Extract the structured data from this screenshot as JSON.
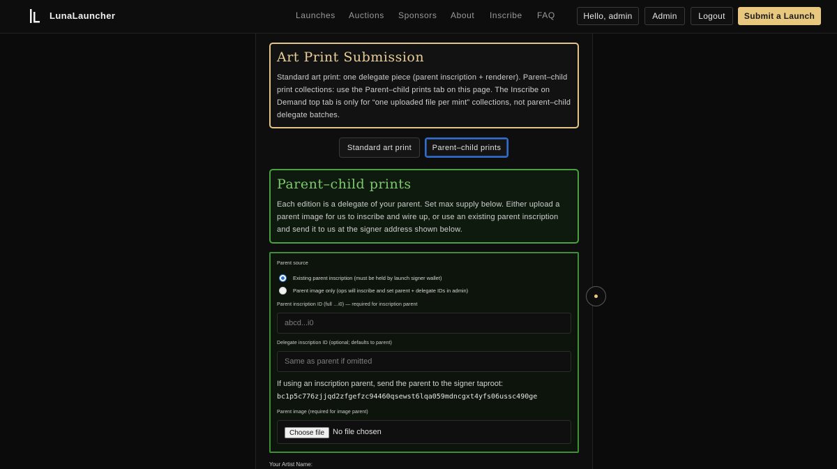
{
  "header": {
    "brand": "LunaLauncher",
    "nav": [
      "Launches",
      "Auctions",
      "Sponsors",
      "About",
      "Inscribe",
      "FAQ"
    ],
    "greeting": "Hello, admin",
    "admin_label": "Admin",
    "logout_label": "Logout",
    "submit_label": "Submit a Launch"
  },
  "intro": {
    "title": "Art Print Submission",
    "text": "Standard art print: one delegate piece (parent inscription + renderer). Parent–child print collections: use the Parent–child prints tab on this page. The Inscribe on Demand top tab is only for “one uploaded file per mint” collections, not parent–child delegate batches."
  },
  "tabs": {
    "standard": "Standard art print",
    "parent_child": "Parent–child prints"
  },
  "pc_panel": {
    "title": "Parent–child prints",
    "text": "Each edition is a delegate of your parent. Set max supply below. Either upload a parent image for us to inscribe and wire up, or use an existing parent inscription and send it to us at the signer address shown below."
  },
  "form": {
    "parent_source_label": "Parent source",
    "option_existing": "Existing parent inscription (must be held by launch signer wallet)",
    "option_image": "Parent image only (ops will inscribe and set parent + delegate IDs in admin)",
    "selected_option": "existing",
    "parent_id_label": "Parent inscription ID (full …i0) — required for inscription parent",
    "parent_id_placeholder": "abcd...i0",
    "delegate_id_label": "Delegate inscription ID (optional; defaults to parent)",
    "delegate_id_placeholder": "Same as parent if omitted",
    "taproot_text": "If using an inscription parent, send the parent to the signer taproot: ",
    "taproot_address": "bc1p5c776zjjqd2zfgefzc94460qsewst6lqa059mdncgxt4yfs06ussc490ge",
    "parent_image_label": "Parent image (required for image parent)",
    "choose_file": "Choose file",
    "no_file": "No file chosen",
    "artist_label": "Your Artist Name:"
  },
  "colors": {
    "accent_gold": "#e8c77e",
    "green_border": "#4aa043",
    "active_tab_blue": "#2f6fd3"
  }
}
